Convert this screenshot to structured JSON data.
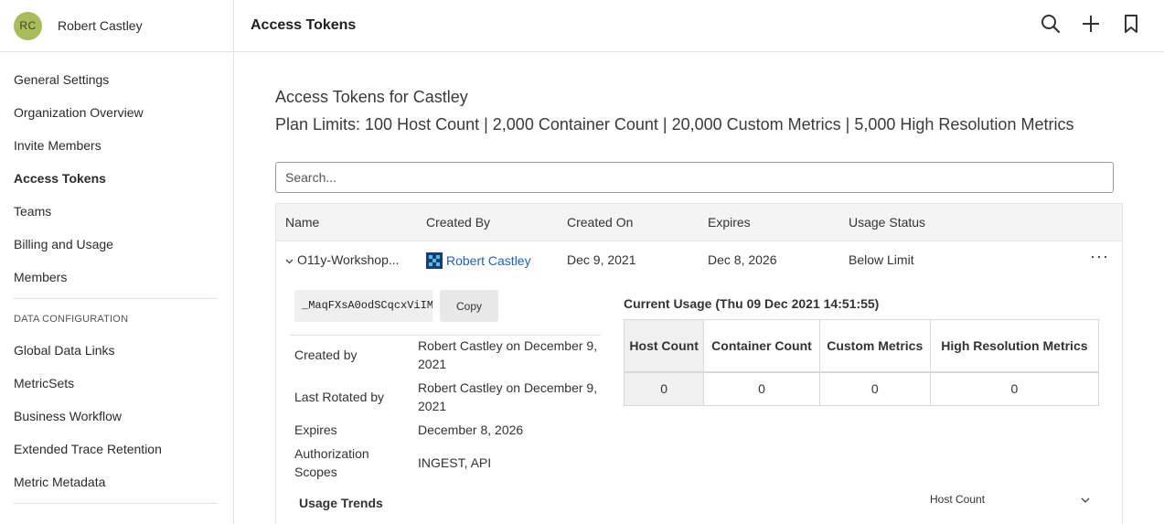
{
  "user": {
    "initials": "RC",
    "name": "Robert Castley"
  },
  "sidebar": {
    "items": [
      {
        "label": "General Settings"
      },
      {
        "label": "Organization Overview"
      },
      {
        "label": "Invite Members"
      },
      {
        "label": "Access Tokens"
      },
      {
        "label": "Teams"
      },
      {
        "label": "Billing and Usage"
      },
      {
        "label": "Members"
      }
    ],
    "section_label": "DATA CONFIGURATION",
    "section_items": [
      {
        "label": "Global Data Links"
      },
      {
        "label": "MetricSets"
      },
      {
        "label": "Business Workflow"
      },
      {
        "label": "Extended Trace Retention"
      },
      {
        "label": "Metric Metadata"
      }
    ]
  },
  "header": {
    "title": "Access Tokens"
  },
  "main": {
    "heading": "Access Tokens for Castley",
    "plan_limits": "Plan Limits: 100 Host Count | 2,000 Container Count | 20,000 Custom Metrics | 5,000 High Resolution Metrics",
    "search_placeholder": "Search..."
  },
  "table": {
    "columns": [
      "Name",
      "Created By",
      "Created On",
      "Expires",
      "Usage Status"
    ],
    "row": {
      "name": "O11y-Workshop...",
      "created_by": "Robert Castley",
      "created_on": "Dec 9, 2021",
      "expires": "Dec 8, 2026",
      "usage_status": "Below Limit",
      "more": "···"
    }
  },
  "detail": {
    "token_value": "_MaqFXsA0odSCqcxViIM",
    "copy_label": "Copy",
    "fields": [
      {
        "label": "Created by",
        "value": "Robert Castley on December 9, 2021"
      },
      {
        "label": "Last Rotated by",
        "value": "Robert Castley on December 9, 2021"
      },
      {
        "label": "Expires",
        "value": "December 8, 2026"
      },
      {
        "label": "Authorization Scopes",
        "value": "INGEST, API"
      }
    ],
    "usage_trends_label": "Usage Trends",
    "current_usage_label": "Current Usage (Thu 09 Dec 2021 14:51:55)",
    "usage_columns": [
      "Host Count",
      "Container Count",
      "Custom Metrics",
      "High Resolution Metrics"
    ],
    "usage_values": [
      "0",
      "0",
      "0",
      "0"
    ],
    "metric_select_value": "Host Count"
  },
  "colors": {
    "avatar": "#a9bb5a",
    "link": "#1d5ec9"
  },
  "icons": [
    "search-icon",
    "plus-icon",
    "bookmark-icon",
    "chevron-down-icon",
    "more-icon"
  ]
}
